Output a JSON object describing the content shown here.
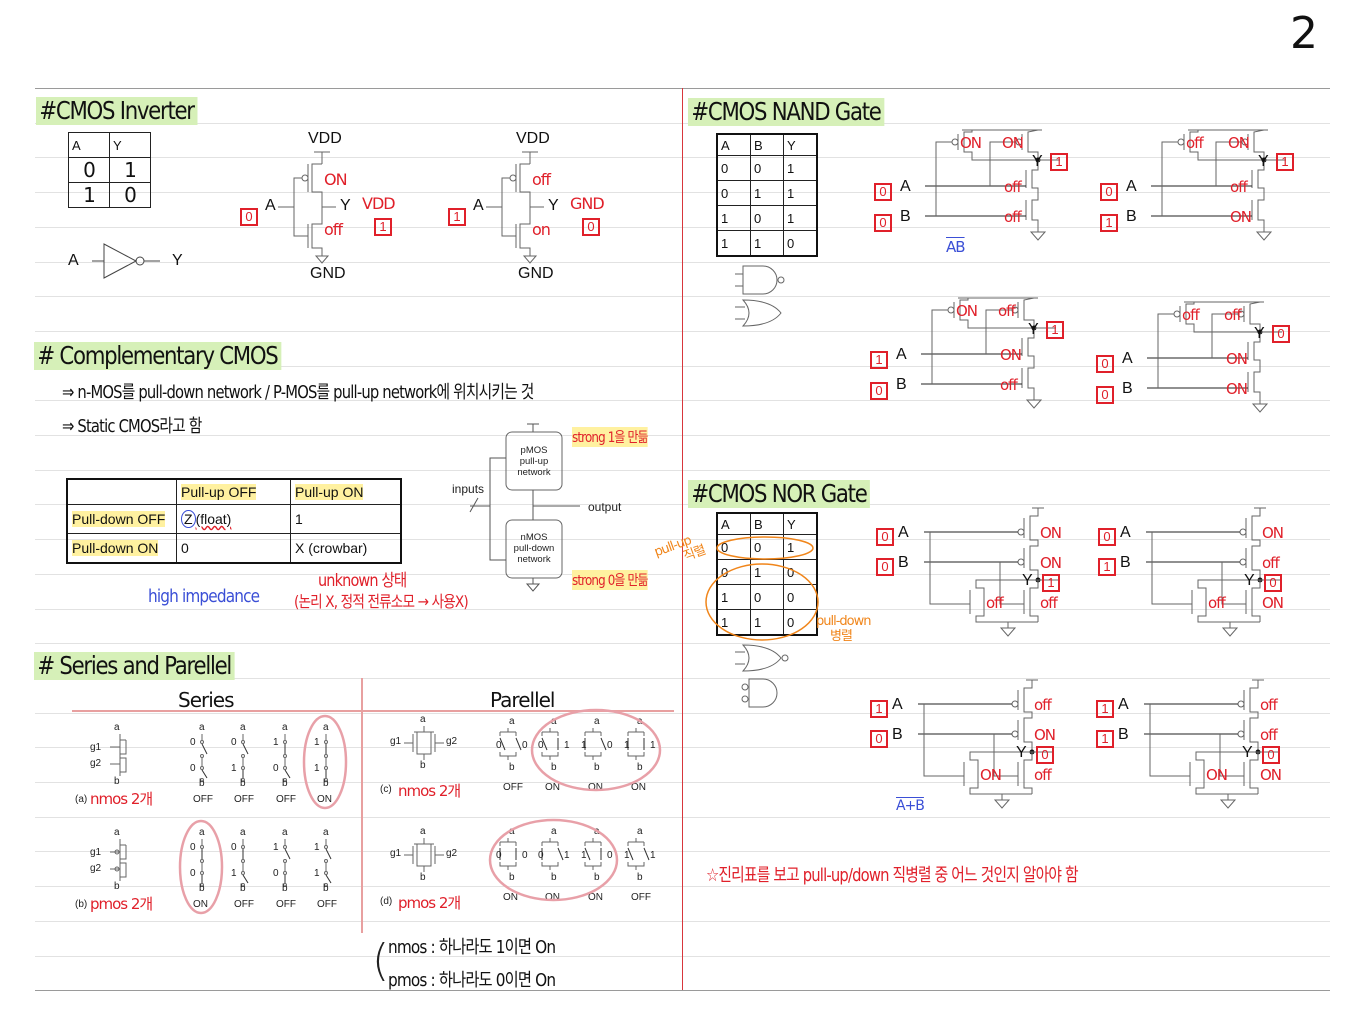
{
  "page_number": "2",
  "inverter": {
    "title": "#CMOS Inverter",
    "table": {
      "headers": [
        "A",
        "Y"
      ],
      "rows": [
        [
          "0",
          "1"
        ],
        [
          "1",
          "0"
        ]
      ]
    },
    "symbol": {
      "input": "A",
      "output": "Y"
    },
    "circuits": [
      {
        "vdd": "VDD",
        "gnd": "GND",
        "input_value": "0",
        "input": "A",
        "top_state": "ON",
        "bottom_state": "off",
        "output": "Y",
        "output_note": "VDD",
        "output_value": "1"
      },
      {
        "vdd": "VDD",
        "gnd": "GND",
        "input_value": "1",
        "input": "A",
        "top_state": "off",
        "bottom_state": "on",
        "output": "Y",
        "output_note": "GND",
        "output_value": "0"
      }
    ]
  },
  "complementary": {
    "title": "# Complementary CMOS",
    "line1": "⇒ n-MOS를 pull-down network / P-MOS를 pull-up network에 위치시키는 것",
    "line2": "⇒ Static CMOS라고 함",
    "table": {
      "col_headers": [
        "Pull-up OFF",
        "Pull-up ON"
      ],
      "rows": [
        {
          "header": "Pull-down OFF",
          "cells": [
            "Z",
            "(float)",
            "1"
          ]
        },
        {
          "header": "Pull-down ON",
          "cells": [
            "0",
            "X (crowbar)"
          ]
        }
      ]
    },
    "note_high_impedance": "high impedance",
    "note_unknown": "unknown 상태",
    "note_unknown_detail": "(논리 X, 정적 전류소모 → 사용X)",
    "diagram": {
      "pmos_block": [
        "pMOS",
        "pull-up",
        "network"
      ],
      "nmos_block": [
        "nMOS",
        "pull-down",
        "network"
      ],
      "inputs": "inputs",
      "output": "output",
      "note_strong1": "strong 1을 만듦",
      "note_strong0": "strong 0을 만듦"
    }
  },
  "series_parallel": {
    "title": "# Series and Parellel",
    "series_label": "Series",
    "parallel_label": "Parellel",
    "symbol_labels": {
      "a": "a",
      "b": "b",
      "g1": "g1",
      "g2": "g2"
    },
    "groups": [
      {
        "caption": "(a)",
        "note": "nmos 2개",
        "kind": "series-n",
        "cases": [
          {
            "g1": "0",
            "g2": "0",
            "state": "OFF"
          },
          {
            "g1": "0",
            "g2": "1",
            "state": "OFF"
          },
          {
            "g1": "1",
            "g2": "0",
            "state": "OFF"
          },
          {
            "g1": "1",
            "g2": "1",
            "state": "ON"
          }
        ],
        "circled": [
          3
        ]
      },
      {
        "caption": "(b)",
        "note": "pmos 2개",
        "kind": "series-p",
        "cases": [
          {
            "g1": "0",
            "g2": "0",
            "state": "ON"
          },
          {
            "g1": "0",
            "g2": "1",
            "state": "OFF"
          },
          {
            "g1": "1",
            "g2": "0",
            "state": "OFF"
          },
          {
            "g1": "1",
            "g2": "1",
            "state": "OFF"
          }
        ],
        "circled": [
          0
        ]
      },
      {
        "caption": "(c)",
        "note": "nmos 2개",
        "kind": "parallel-n",
        "cases": [
          {
            "g1": "0",
            "g2": "0",
            "state": "OFF"
          },
          {
            "g1": "0",
            "g2": "1",
            "state": "ON"
          },
          {
            "g1": "1",
            "g2": "0",
            "state": "ON"
          },
          {
            "g1": "1",
            "g2": "1",
            "state": "ON"
          }
        ],
        "circled": [
          1,
          2,
          3
        ]
      },
      {
        "caption": "(d)",
        "note": "pmos 2개",
        "kind": "parallel-p",
        "cases": [
          {
            "g1": "0",
            "g2": "0",
            "state": "ON"
          },
          {
            "g1": "0",
            "g2": "1",
            "state": "ON"
          },
          {
            "g1": "1",
            "g2": "0",
            "state": "ON"
          },
          {
            "g1": "1",
            "g2": "1",
            "state": "OFF"
          }
        ],
        "circled": [
          0,
          1,
          2
        ]
      }
    ],
    "summary": [
      "nmos : 하나라도 1이면 On",
      "pmos : 하나라도 0이면 On"
    ]
  },
  "nand": {
    "title": "#CMOS NAND Gate",
    "table": {
      "headers": [
        "A",
        "B",
        "Y"
      ],
      "rows": [
        [
          "0",
          "0",
          "1"
        ],
        [
          "0",
          "1",
          "1"
        ],
        [
          "1",
          "0",
          "1"
        ],
        [
          "1",
          "1",
          "0"
        ]
      ]
    },
    "circuits": [
      {
        "a": "0",
        "b": "0",
        "p1": "ON",
        "p2": "ON",
        "n1": "off",
        "n2": "off",
        "y": "1",
        "note": "AB"
      },
      {
        "a": "0",
        "b": "1",
        "p1": "off",
        "p2": "ON",
        "n1": "off",
        "n2": "ON",
        "y": "1"
      },
      {
        "a": "1",
        "b": "0",
        "p1": "ON",
        "p2": "off",
        "n1": "ON",
        "n2": "off",
        "y": "1"
      },
      {
        "a": "0",
        "b": "0",
        "p1": "off",
        "p2": "off",
        "n1": "ON",
        "n2": "ON",
        "y": "0"
      }
    ],
    "labels": {
      "A": "A",
      "B": "B",
      "Y": "Y"
    }
  },
  "nor": {
    "title": "#CMOS NOR Gate",
    "table": {
      "headers": [
        "A",
        "B",
        "Y"
      ],
      "rows": [
        [
          "0",
          "0",
          "1"
        ],
        [
          "0",
          "1",
          "0"
        ],
        [
          "1",
          "0",
          "0"
        ],
        [
          "1",
          "1",
          "0"
        ]
      ]
    },
    "note_pullup": [
      "pull-up",
      "직렬"
    ],
    "note_pulldown": [
      "pull-down",
      "병렬"
    ],
    "circuits": [
      {
        "a": "0",
        "b": "0",
        "p1": "ON",
        "p2": "ON",
        "n1": "off",
        "n2": "off",
        "y": "1"
      },
      {
        "a": "0",
        "b": "1",
        "p1": "ON",
        "p2": "off",
        "n1": "off",
        "n2": "ON",
        "y": "0"
      },
      {
        "a": "1",
        "b": "0",
        "p1": "off",
        "p2": "ON",
        "n1": "ON",
        "n2": "off",
        "y": "0",
        "note": "A+B"
      },
      {
        "a": "1",
        "b": "1",
        "p1": "off",
        "p2": "off",
        "n1": "ON",
        "n2": "ON",
        "y": "0"
      }
    ],
    "labels": {
      "A": "A",
      "B": "B",
      "Y": "Y"
    }
  },
  "footer_note": "☆진리표를 보고 pull-up/down 직병렬 중 어느 것인지 알아야 함",
  "colors": {
    "pen_red": "#e0202a",
    "pen_blue": "#3b4fd6",
    "pen_orange": "#f0851a",
    "heading_highlight": "#d6f0b8",
    "marker_yellow": "#fff1a0",
    "divider_red": "#d8363c"
  }
}
